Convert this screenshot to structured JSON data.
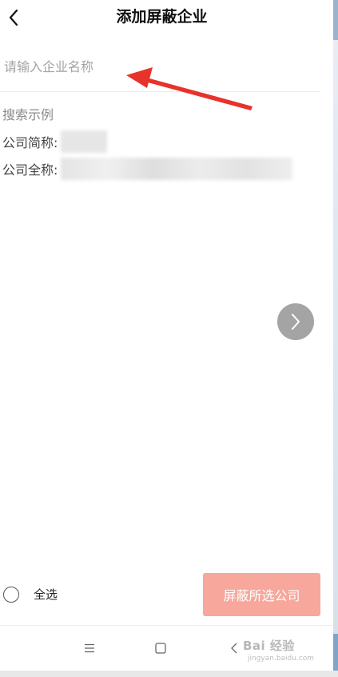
{
  "header": {
    "title": "添加屏蔽企业",
    "back_icon": "chevron-left-icon"
  },
  "search": {
    "placeholder": "请输入企业名称",
    "value": ""
  },
  "example": {
    "title": "搜索示例",
    "short_name_label": "公司简称:",
    "full_name_label": "公司全称:"
  },
  "next_button_icon": "chevron-right-icon",
  "bottom": {
    "select_all_label": "全选",
    "block_button_label": "屏蔽所选公司",
    "block_button_color": "#f7a79b"
  },
  "system_nav": {
    "menu_icon": "menu-icon",
    "home_icon": "home-icon",
    "back_icon": "back-icon"
  },
  "watermark": {
    "main": "Bai 经验",
    "sub": "jingyan.baidu.com"
  },
  "annotation_arrow_color": "#e8322a"
}
